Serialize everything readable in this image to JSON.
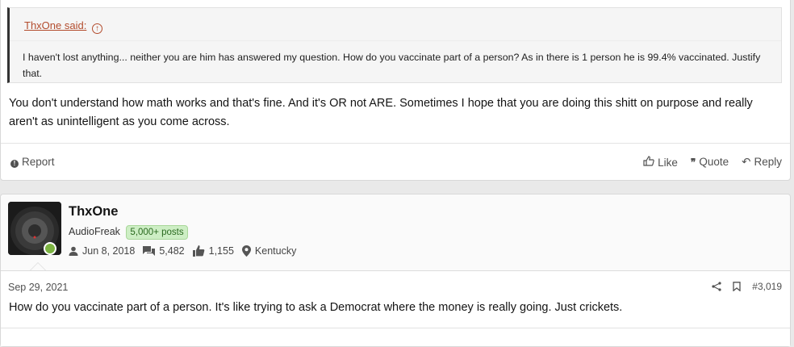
{
  "post1": {
    "quote": {
      "author": "ThxOne said:",
      "text": "I haven't lost anything... neither you are him has answered my question. How do you vaccinate part of a person? As in there is 1 person he is 99.4% vaccinated. Justify that."
    },
    "body": "You don't understand how math works and that's fine. And it's OR not ARE. Sometimes I hope that you are doing this shitt on purpose and really aren't as unintelligent as you come across.",
    "actions": {
      "report": "Report",
      "like": "Like",
      "quote": "Quote",
      "reply": "Reply"
    }
  },
  "post2": {
    "user": {
      "name": "ThxOne",
      "title": "AudioFreak",
      "badge": "5,000+ posts",
      "joined": "Jun 8, 2018",
      "messages": "5,482",
      "reactions": "1,155",
      "location": "Kentucky"
    },
    "date": "Sep 29, 2021",
    "number": "#3,019",
    "body": "How do you vaccinate part of a person. It's like trying to ask a Democrat where the money is really going. Just crickets."
  },
  "colors": {
    "quote_link": "#b34c2d",
    "badge_bg": "#cdeec4",
    "online": "#7cb342"
  }
}
